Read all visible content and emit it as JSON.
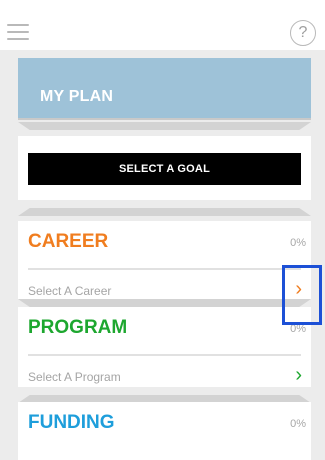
{
  "header": {
    "menu_icon": "hamburger-icon",
    "help_icon": "help-icon",
    "help_glyph": "?"
  },
  "plan": {
    "title": "MY PLAN"
  },
  "goal": {
    "button_label": "SELECT A GOAL"
  },
  "sections": [
    {
      "title": "CAREER",
      "percent": "0%",
      "select_label": "Select A Career",
      "chevron": "›",
      "color": "#f07d1f"
    },
    {
      "title": "PROGRAM",
      "percent": "0%",
      "select_label": "Select A Program",
      "chevron": "›",
      "color": "#1da72f"
    },
    {
      "title": "FUNDING",
      "percent": "0%",
      "color": "#1e9edb"
    }
  ],
  "colors": {
    "plan_header": "#9ec2d8",
    "highlight": "#1c50d6"
  }
}
